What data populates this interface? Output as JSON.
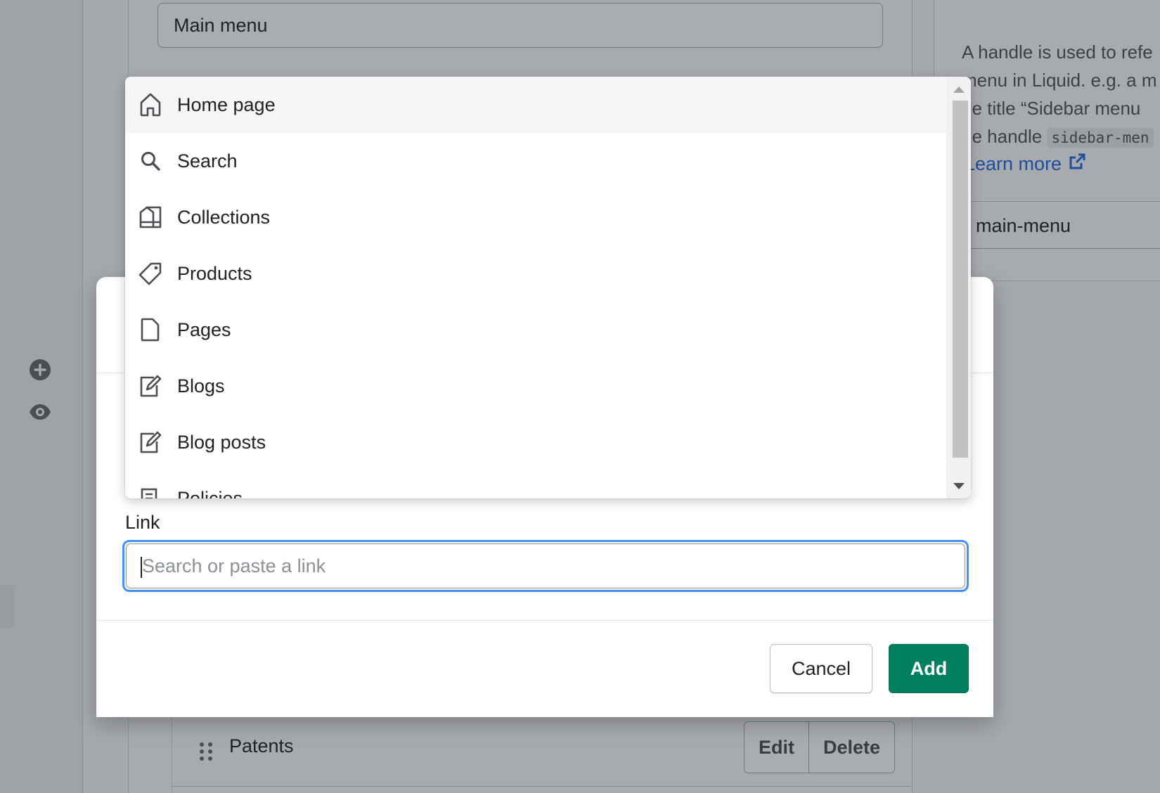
{
  "background": {
    "menu_title_value": "Main menu",
    "help_lines": [
      "A handle is used to refe",
      "menu in Liquid. e.g. a m",
      "he title “Sidebar menu",
      "he handle "
    ],
    "help_code": "sidebar-men",
    "learn_more": "Learn more",
    "handle_value": "main-menu",
    "row_label": "Patents",
    "edit_label": "Edit",
    "delete_label": "Delete"
  },
  "modal": {
    "link_label": "Link",
    "link_placeholder": "Search or paste a link",
    "cancel_label": "Cancel",
    "add_label": "Add"
  },
  "dropdown": {
    "items": [
      {
        "label": "Home page",
        "icon": "home-icon"
      },
      {
        "label": "Search",
        "icon": "search-icon"
      },
      {
        "label": "Collections",
        "icon": "collections-icon"
      },
      {
        "label": "Products",
        "icon": "tag-icon"
      },
      {
        "label": "Pages",
        "icon": "page-icon"
      },
      {
        "label": "Blogs",
        "icon": "blog-icon"
      },
      {
        "label": "Blog posts",
        "icon": "blog-post-icon"
      },
      {
        "label": "Policies",
        "icon": "policy-icon"
      }
    ]
  },
  "colors": {
    "primary": "#008060",
    "focus": "#458fff",
    "link": "#2c6ecb"
  }
}
